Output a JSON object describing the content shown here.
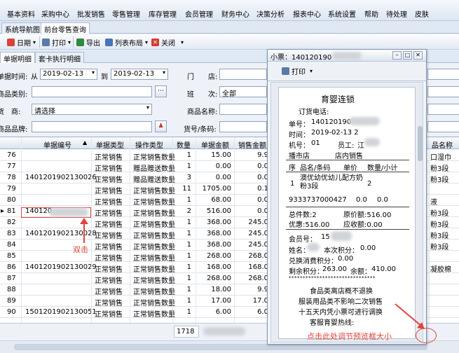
{
  "menu": [
    "基本资料",
    "采购中心",
    "批发销售",
    "零售管理",
    "库存管理",
    "会员管理",
    "财务中心",
    "决策分析",
    "报表中心",
    "系统设置",
    "帮助",
    "待处理",
    "皮肤"
  ],
  "tabs": {
    "nav": "系统导航图",
    "active": "前台零售查询"
  },
  "toolbar": {
    "date": "日期",
    "print": "打印",
    "export": "导出",
    "layout": "列表布局",
    "close": "关闭"
  },
  "subtabs": {
    "bill_detail": "单据明细",
    "card_detail": "套卡执行明细"
  },
  "form": {
    "bill_time_label": "单据时间:",
    "from": "从",
    "from_date": "2019-02-13",
    "to": "到",
    "to_date": "2019-02-13",
    "product_type_label": "商品类别:",
    "merchant_label": "货　商:",
    "merchant_value": "请选择",
    "brand_label": "商品品牌:",
    "store_label": "门　　店:",
    "shift_label": "班　　次:",
    "shift_value": "全部",
    "product_name_label": "商品名称:",
    "barcode_label": "货号/条码:"
  },
  "grid": {
    "headers": [
      "单据编号",
      "单据类型",
      "操作类型",
      "数量",
      "单据金额",
      "销售金额",
      "品名称"
    ],
    "sort_icon": "▲",
    "rows": [
      {
        "n": "76",
        "no": "",
        "type": "正常销售",
        "op": "正常销售数量",
        "qty": "1",
        "amt": "15.00",
        "sale": "9.9",
        "tail": "口湿巾"
      },
      {
        "n": "77",
        "no": "",
        "type": "正常销售",
        "op": "赠品赠送数量",
        "qty": "1",
        "amt": "0.00",
        "sale": "0.0",
        "tail": "粉3段"
      },
      {
        "n": "78",
        "no": "1401201902130026",
        "type": "正常销售",
        "op": "赠品赠送数量",
        "qty": "3",
        "amt": "0.00",
        "sale": "0.0",
        "tail": "粉3段"
      },
      {
        "n": "79",
        "no": "",
        "type": "正常销售",
        "op": "正常销售数量",
        "qty": "11",
        "amt": "1705.00",
        "sale": "0.1",
        "tail": ""
      },
      {
        "n": "80",
        "no": "",
        "type": "正常销售",
        "op": "正常销售数量",
        "qty": "1",
        "amt": "68.00",
        "sale": "0.0",
        "tail": "液"
      },
      {
        "n": "81",
        "no": "140120",
        "type": "正常销售",
        "op": "正常销售数量",
        "qty": "2",
        "amt": "516.00",
        "sale": "0.0",
        "tail": "粉3段"
      },
      {
        "n": "82",
        "no": "",
        "type": "正常销售",
        "op": "正常销售数量",
        "qty": "1",
        "amt": "368.00",
        "sale": "245.0",
        "tail": "粉3段"
      },
      {
        "n": "83",
        "no": "1401201902130028",
        "type": "正常销售",
        "op": "正常销售数量",
        "qty": "1",
        "amt": "368.00",
        "sale": "245.0",
        "tail": "粉3段"
      },
      {
        "n": "84",
        "no": "",
        "type": "正常销售",
        "op": "正常销售数量",
        "qty": "1",
        "amt": "368.00",
        "sale": "245.0",
        "tail": "粉3段"
      },
      {
        "n": "85",
        "no": "",
        "type": "正常销售",
        "op": "正常销售数量",
        "qty": "1",
        "amt": "268.00",
        "sale": "268.0",
        "tail": ""
      },
      {
        "n": "86",
        "no": "1401201902130029",
        "type": "正常销售",
        "op": "正常销售数量",
        "qty": "1",
        "amt": "168.00",
        "sale": "168.0",
        "tail": "凝胶棉"
      },
      {
        "n": "87",
        "no": "",
        "type": "正常销售",
        "op": "正常销售数量",
        "qty": "1",
        "amt": "268.00",
        "sale": "268.0",
        "tail": ""
      },
      {
        "n": "88",
        "no": "",
        "type": "正常销售",
        "op": "正常销售数量",
        "qty": "1",
        "amt": "18.00",
        "sale": "9.9",
        "tail": ""
      },
      {
        "n": "89",
        "no": "",
        "type": "正常销售",
        "op": "正常销售数量",
        "qty": "1",
        "amt": "17.00",
        "sale": "17.0",
        "tail": ""
      },
      {
        "n": "90",
        "no": "1501201902130051",
        "type": "正常销售",
        "op": "正常销售数量",
        "qty": "1",
        "amt": "6.00",
        "sale": "6.0",
        "tail": ""
      }
    ],
    "current_row": "81"
  },
  "footer": {
    "total_qty": "1718"
  },
  "annotations": {
    "double_click": "双击",
    "resize_hint": "点击此处调节预览框大小"
  },
  "popup": {
    "title": "小票：140120190",
    "print": "打印",
    "receipt": {
      "store": "育婴连锁",
      "order_phone": "订货电话:",
      "bill_no_label": "单号：",
      "bill_no": "140120190",
      "time_label": "时间：",
      "time": "2019-02-13 2",
      "machine_label": "机号：",
      "machine": "01",
      "staff_label": "员工:",
      "staff": "江",
      "shop": "播市店",
      "sale_kind": "店内销售",
      "col_seq": "序",
      "col_code": "品名/条码",
      "col_price": "单价",
      "col_qty": "数量/小计",
      "item_seq": "1",
      "item_name": "澳优幼优幼儿配方奶粉3段",
      "item_qty": "2",
      "barcode": "9333737000427",
      "price": "0.0",
      "subtotal": "0.0",
      "total_qty": "总件数:2",
      "orig_amt": "原价额:516.00",
      "discount": "优惠:516.00",
      "receivable": "应收额:0.00",
      "member_no_label": "会员号：",
      "member_no": "15",
      "name_label": "姓名：",
      "points_label": "本次积分：",
      "points": "0.00",
      "exchange": "兑换消费积分：",
      "exchange_val": "0.00",
      "remain_label": "剩余积分：",
      "remain": "263.00",
      "balance_label": "余额：",
      "balance": "410.00",
      "stars": "*******************************",
      "note1": "食品类离店概不退换",
      "note2": "服装用品类不影响二次销售",
      "note3": "十五天内凭小票可进行调换",
      "hotline": "客服育婴热线:"
    }
  },
  "colors": {
    "accent_red": "#e0443c",
    "header_bg": "#dbe4f0"
  }
}
